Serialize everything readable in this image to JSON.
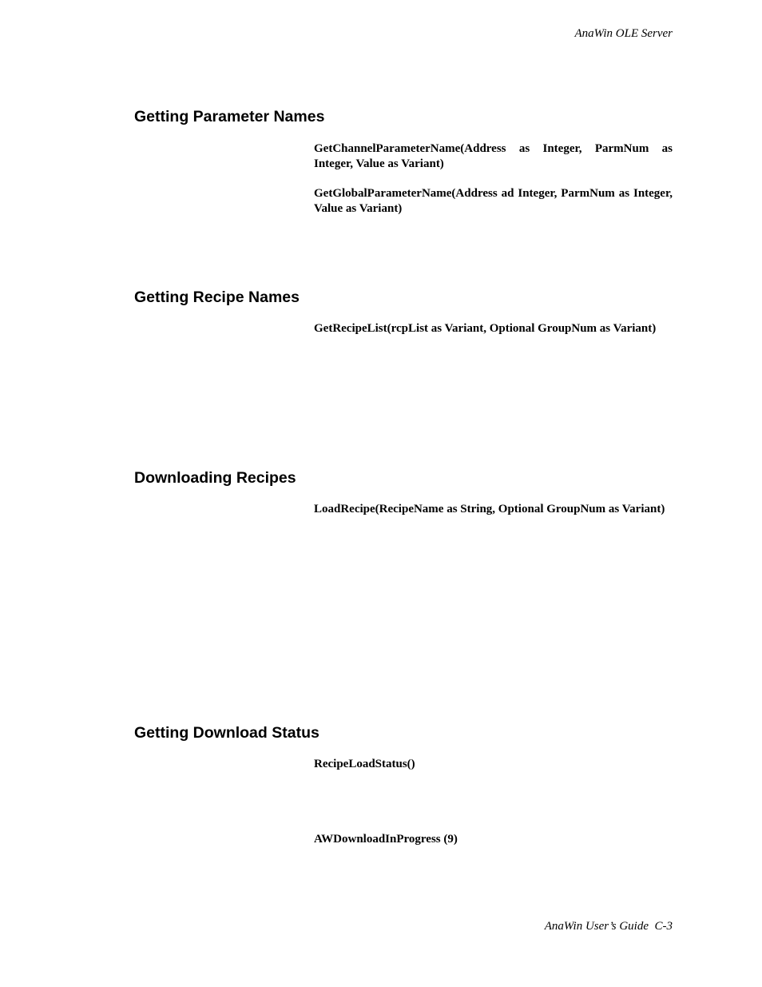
{
  "header": {
    "running_title": "AnaWin OLE Server"
  },
  "sections": [
    {
      "heading": "Getting Parameter Names",
      "signatures": [
        "GetChannelParameterName(Address as Integer, ParmNum as Integer, Value as Variant)",
        "GetGlobalParameterName(Address ad Integer, ParmNum as Integer, Value as Variant)"
      ]
    },
    {
      "heading": "Getting Recipe Names",
      "signatures": [
        "GetRecipeList(rcpList as Variant, Optional GroupNum as Variant)"
      ]
    },
    {
      "heading": "Downloading Recipes",
      "signatures": [
        "LoadRecipe(RecipeName as String, Optional GroupNum as Variant)"
      ]
    },
    {
      "heading": "Getting Download Status",
      "signatures": [
        "RecipeLoadStatus()",
        "AWDownloadInProgress (9)"
      ]
    }
  ],
  "footer": {
    "running_footer": "AnaWin User’s Guide  C-3"
  }
}
